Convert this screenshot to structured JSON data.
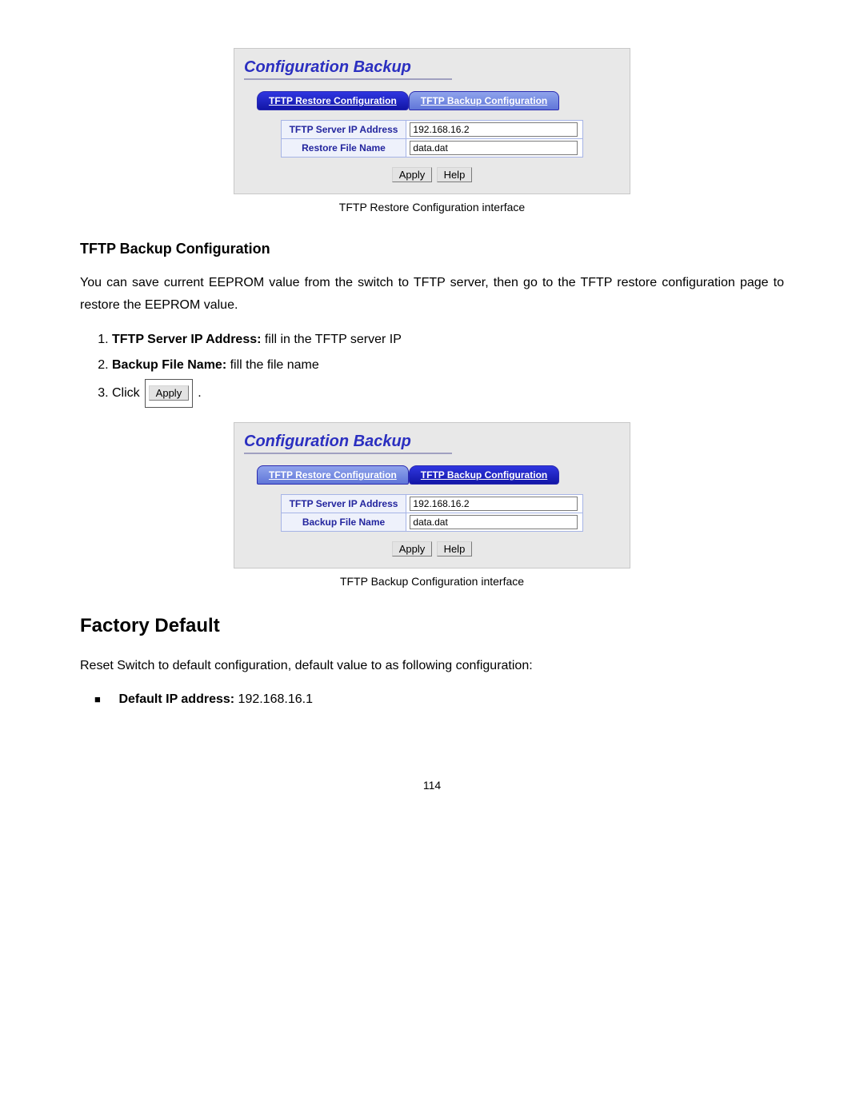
{
  "panel1": {
    "title": "Configuration Backup",
    "tabs": {
      "restore": "TFTP Restore Configuration",
      "backup": "TFTP Backup Configuration"
    },
    "row_ip_label": "TFTP Server IP Address",
    "row_ip_value": "192.168.16.2",
    "row_file_label": "Restore File Name",
    "row_file_value": "data.dat",
    "btn_apply": "Apply",
    "btn_help": "Help",
    "caption": "TFTP Restore Configuration interface"
  },
  "section1": {
    "heading": "TFTP Backup Configuration",
    "para": "You can save current EEPROM value from the switch to TFTP server, then go to the TFTP restore configuration page to restore the EEPROM value.",
    "step1_bold": "TFTP Server IP Address:",
    "step1_rest": " fill in the TFTP server IP",
    "step2_bold": "Backup File Name:",
    "step2_rest": " fill the file name",
    "step3_lead": "Click ",
    "step3_btn": "Apply",
    "step3_tail": "."
  },
  "panel2": {
    "title": "Configuration Backup",
    "tabs": {
      "restore": "TFTP Restore Configuration",
      "backup": "TFTP Backup Configuration"
    },
    "row_ip_label": "TFTP Server IP Address",
    "row_ip_value": "192.168.16.2",
    "row_file_label": "Backup File Name",
    "row_file_value": "data.dat",
    "btn_apply": "Apply",
    "btn_help": "Help",
    "caption": "TFTP Backup Configuration interface"
  },
  "section2": {
    "heading": "Factory Default",
    "para": "Reset Switch to default configuration, default value to as following configuration:",
    "bullet1_bold": "Default IP address:",
    "bullet1_rest": " 192.168.16.1"
  },
  "page_number": "114"
}
